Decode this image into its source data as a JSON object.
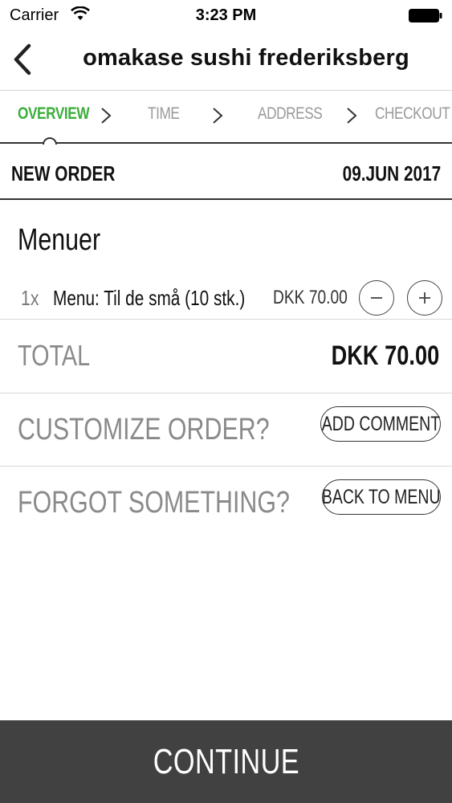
{
  "status_bar": {
    "carrier": "Carrier",
    "time": "3:23 PM",
    "icons": [
      "wifi-icon",
      "battery-icon"
    ]
  },
  "nav": {
    "title": "omakase sushi frederiksberg",
    "back_icon": "chevron-left-icon"
  },
  "steps": {
    "items": [
      {
        "label": "OVERVIEW",
        "active": true
      },
      {
        "label": "TIME",
        "active": false
      },
      {
        "label": "ADDRESS",
        "active": false
      },
      {
        "label": "CHECKOUT",
        "active": false
      }
    ],
    "separator_icon": "chevron-right-icon",
    "active_color": "#3cae3c",
    "inactive_color": "#9a9a9a"
  },
  "order": {
    "label": "NEW ORDER",
    "date": "09.JUN 2017"
  },
  "menu_section": {
    "title": "Menuer",
    "items": [
      {
        "qty": "1x",
        "name": "Menu: Til de små (10 stk.)",
        "price": "DKK 70.00"
      }
    ]
  },
  "total": {
    "label": "TOTAL",
    "value": "DKK 70.00"
  },
  "customize": {
    "label": "CUSTOMIZE ORDER?",
    "button": "ADD COMMENT"
  },
  "forgot": {
    "label": "FORGOT SOMETHING?",
    "button": "BACK TO MENU"
  },
  "footer": {
    "continue_label": "CONTINUE",
    "background": "#414141"
  }
}
